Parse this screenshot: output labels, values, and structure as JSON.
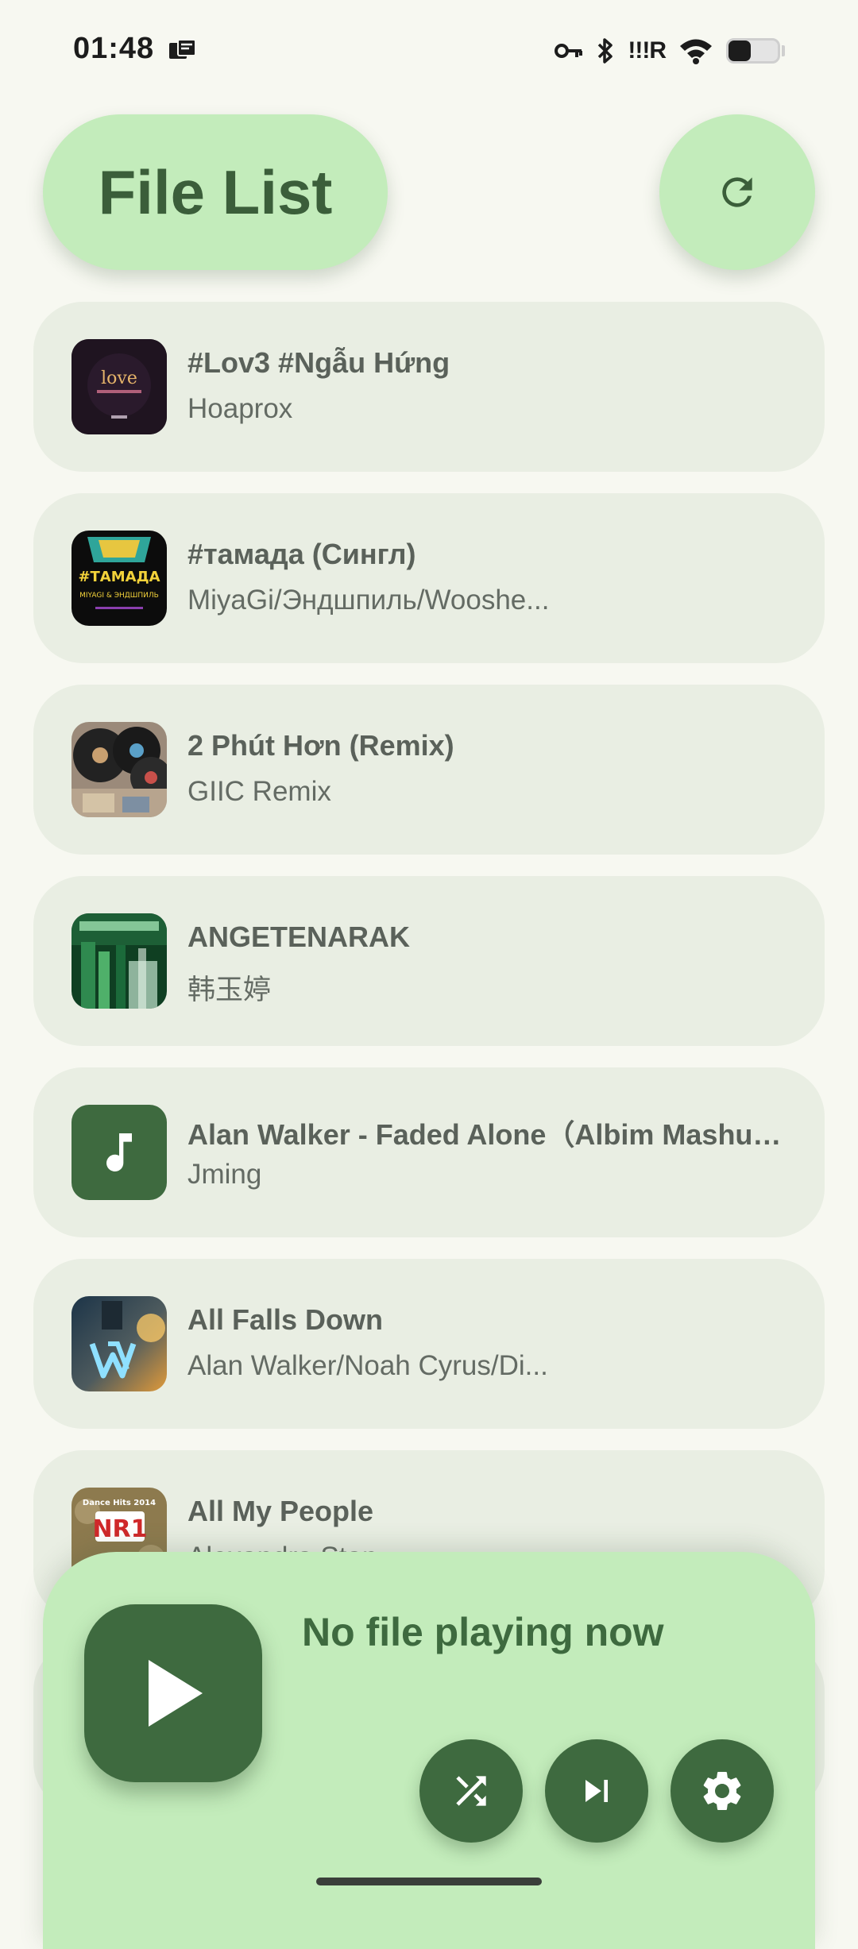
{
  "status_bar": {
    "time": "01:48",
    "signal_text": "!!!R",
    "battery_level": 0.45,
    "icons": [
      "notification-icon",
      "vpn-key-icon",
      "bluetooth-icon",
      "signal-icon",
      "wifi-icon",
      "battery-icon"
    ]
  },
  "header": {
    "title": "File List",
    "refresh_icon": "refresh-icon"
  },
  "files": [
    {
      "title": "#Lov3 #Ngẫu Hứng",
      "artist": "Hoaprox",
      "thumb": "album-art-lov3"
    },
    {
      "title": "#тамада (Сингл)",
      "artist": "MiyaGi/Эндшпиль/Wooshe...",
      "thumb": "album-art-tamada"
    },
    {
      "title": "2 Phút Hơn (Remix)",
      "artist": "GIIC Remix",
      "thumb": "album-art-vinyl"
    },
    {
      "title": "ANGETENARAK",
      "artist": "韩玉婷",
      "thumb": "album-art-green"
    },
    {
      "title": "Alan Walker - Faded Alone（Albim Mashup ...",
      "artist": "Jming",
      "thumb": "music-note-icon"
    },
    {
      "title": "All Falls Down",
      "artist": "Alan Walker/Noah Cyrus/Di...",
      "thumb": "album-art-alan-walker"
    },
    {
      "title": "All My People",
      "artist": "Alexandra Stan",
      "thumb": "album-art-nr1"
    }
  ],
  "thumb_texts": {
    "lov3": "love",
    "tamada": "#ТАМАДА",
    "tamada_sub": "MIYAGI & ЭНДШПИЛЬ",
    "nr1_top": "Dance Hits 2014",
    "nr1": "NR1"
  },
  "player": {
    "status": "No file playing now",
    "play_icon": "play-icon",
    "shuffle_icon": "shuffle-icon",
    "next_icon": "skip-next-icon",
    "settings_icon": "settings-icon"
  },
  "colors": {
    "background": "#f7f8f1",
    "accent_container": "#c3ecbb",
    "accent_dark": "#3e6a3f",
    "list_item_bg": "#e9eee3"
  }
}
